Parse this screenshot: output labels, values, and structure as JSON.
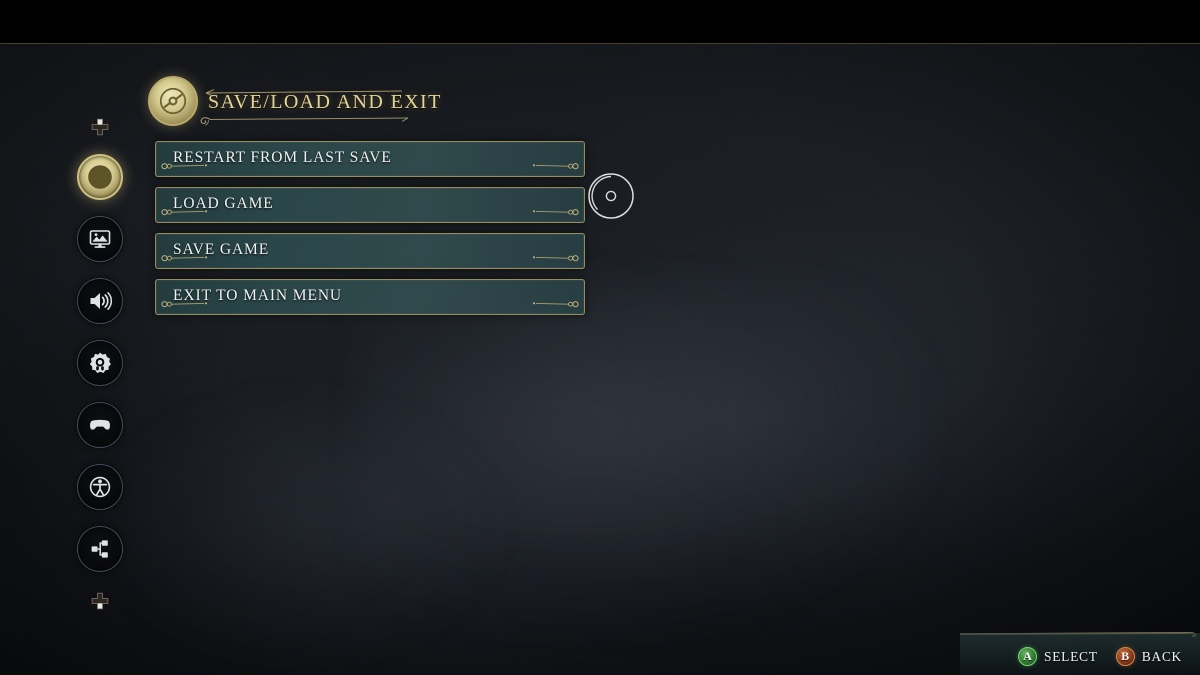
{
  "screen": {
    "title": "SAVE/LOAD AND EXIT",
    "title_icon": "save-disc-emblem-icon",
    "background_description": "dark blurred in-game scene"
  },
  "sidebar": {
    "nav_up_icon": "dpad-up-icon",
    "nav_down_icon": "dpad-down-icon",
    "items": [
      {
        "id": "save-load-exit",
        "icon": "save-disc-icon",
        "selected": true
      },
      {
        "id": "display",
        "icon": "display-monitor-icon",
        "selected": false
      },
      {
        "id": "audio",
        "icon": "speaker-volume-icon",
        "selected": false
      },
      {
        "id": "gameplay",
        "icon": "gear-icon",
        "selected": false
      },
      {
        "id": "controls",
        "icon": "gamepad-icon",
        "selected": false
      },
      {
        "id": "accessibility",
        "icon": "accessibility-person-icon",
        "selected": false
      },
      {
        "id": "network",
        "icon": "network-nodes-icon",
        "selected": false
      }
    ]
  },
  "menu": {
    "items": [
      {
        "label": "RESTART FROM LAST SAVE"
      },
      {
        "label": "LOAD GAME"
      },
      {
        "label": "SAVE GAME"
      },
      {
        "label": "EXIT TO MAIN MENU"
      }
    ],
    "cursor_on_index": 1,
    "cursor_icon": "selection-ring-cursor-icon"
  },
  "footer": {
    "hints": [
      {
        "button": "A",
        "label": "SELECT",
        "color": "#2e7d32"
      },
      {
        "button": "B",
        "label": "BACK",
        "color": "#8b3a1d"
      }
    ]
  },
  "colors": {
    "gold": "#e3d49a",
    "gold_border": "#b2a068",
    "panel_teal": "#2c4a4c",
    "text": "#eef1f2"
  }
}
